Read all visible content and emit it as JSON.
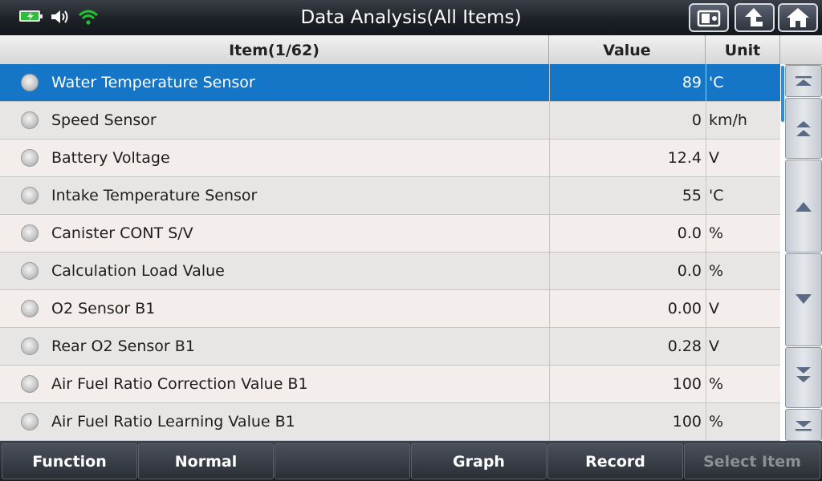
{
  "header": {
    "title": "Data Analysis(All Items)",
    "status_icons": [
      "battery-charging-icon",
      "speaker-volume-icon",
      "wifi-icon"
    ],
    "buttons": [
      "screenshot-icon",
      "back-arrow-icon",
      "home-icon"
    ]
  },
  "table": {
    "columns": {
      "item": "Item(1/62)",
      "value": "Value",
      "unit": "Unit"
    },
    "rows": [
      {
        "name": "Water Temperature Sensor",
        "value": "89",
        "unit": "'C"
      },
      {
        "name": "Speed Sensor",
        "value": "0",
        "unit": "km/h"
      },
      {
        "name": "Battery Voltage",
        "value": "12.4",
        "unit": "V"
      },
      {
        "name": "Intake Temperature Sensor",
        "value": "55",
        "unit": "'C"
      },
      {
        "name": "Canister CONT S/V",
        "value": "0.0",
        "unit": "%"
      },
      {
        "name": "Calculation Load Value",
        "value": "0.0",
        "unit": "%"
      },
      {
        "name": "O2 Sensor B1",
        "value": "0.00",
        "unit": "V"
      },
      {
        "name": "Rear O2 Sensor B1",
        "value": "0.28",
        "unit": "V"
      },
      {
        "name": "Air Fuel Ratio Correction Value B1",
        "value": "100",
        "unit": "%"
      },
      {
        "name": "Air Fuel Ratio Learning Value B1",
        "value": "100",
        "unit": "%"
      }
    ],
    "selected_index": 0
  },
  "scroll_buttons": [
    "scroll-top-icon",
    "page-up-icon",
    "scroll-up-icon",
    "scroll-down-icon",
    "page-down-icon",
    "scroll-bottom-icon"
  ],
  "bottom_bar": {
    "buttons": [
      {
        "label": "Function",
        "enabled": true
      },
      {
        "label": "Normal",
        "enabled": true
      },
      {
        "label": "",
        "enabled": true
      },
      {
        "label": "Graph",
        "enabled": true
      },
      {
        "label": "Record",
        "enabled": true
      },
      {
        "label": "Select Item",
        "enabled": false
      }
    ]
  },
  "colors": {
    "selection": "#1576c8",
    "scroll_thumb": "#2a8de0",
    "battery": "#2bbf3a",
    "wifi": "#22c02f"
  }
}
